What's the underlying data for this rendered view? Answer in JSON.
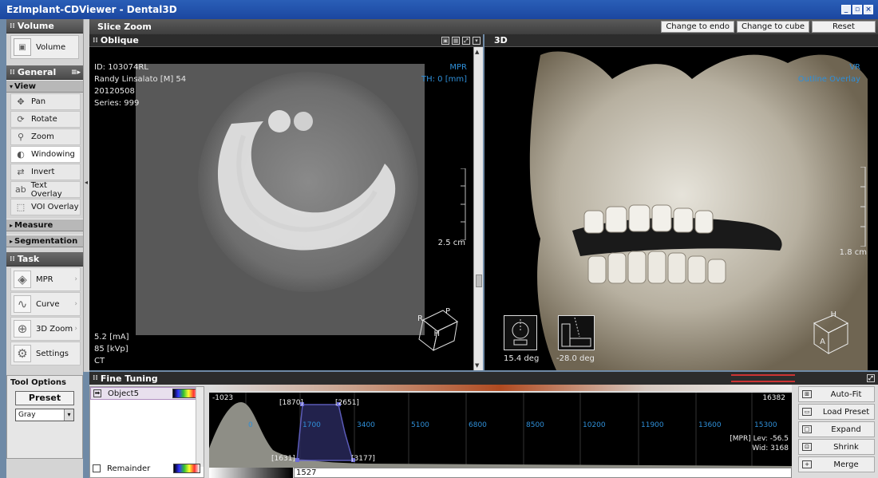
{
  "window": {
    "title": "EzImplant-CDViewer - Dental3D"
  },
  "left": {
    "volume_section": "Volume",
    "volume_button": "Volume",
    "general_section": "General",
    "view_subheader": "View",
    "view_tools": [
      {
        "label": "Pan",
        "icon": "pan-icon"
      },
      {
        "label": "Rotate",
        "icon": "rotate-icon"
      },
      {
        "label": "Zoom",
        "icon": "zoom-icon"
      },
      {
        "label": "Windowing",
        "icon": "windowing-icon"
      },
      {
        "label": "Invert",
        "icon": "invert-icon"
      },
      {
        "label": "Text Overlay",
        "icon": "text-overlay-icon"
      },
      {
        "label": "VOI Overlay",
        "icon": "voi-overlay-icon"
      }
    ],
    "measure_subheader": "Measure",
    "segmentation_subheader": "Segmentation",
    "task_section": "Task",
    "task_tools": [
      {
        "label": "MPR",
        "icon": "mpr-icon"
      },
      {
        "label": "Curve",
        "icon": "curve-icon"
      },
      {
        "label": "3D Zoom",
        "icon": "3d-zoom-icon"
      },
      {
        "label": "Settings",
        "icon": "settings-icon"
      }
    ],
    "tool_options": {
      "title": "Tool Options",
      "preset_label": "Preset",
      "select_value": "Gray"
    }
  },
  "slicezoom": {
    "title": "Slice Zoom",
    "buttons": [
      "Change to endo",
      "Change to cube",
      "Reset"
    ]
  },
  "oblique": {
    "title": "Oblique",
    "patient_id": "ID: 103074RL",
    "patient_name": "Randy Linsalato [M] 54",
    "date": "20120508",
    "series": "Series: 999",
    "mode": "MPR",
    "thickness": "TH: 0 [mm]",
    "scale": "2.5 cm",
    "ma": "5.2 [mA]",
    "kvp": "85 [kVp]",
    "modality": "CT",
    "cube": {
      "r": "R",
      "p": "P",
      "h": "H"
    }
  },
  "view3d": {
    "title": "3D",
    "mode": "VR",
    "overlay": "Outline Overlay",
    "scale": "1.8 cm",
    "angle1": "15.4 deg",
    "angle2": "-28.0 deg",
    "cube": {
      "h": "H",
      "a": "A"
    }
  },
  "finetuning": {
    "title": "Fine Tuning",
    "objects": [
      {
        "label": "Object5",
        "selected": true
      },
      {
        "label": "Remainder",
        "selected": false
      }
    ],
    "hist": {
      "min": "-1023",
      "max": "16382",
      "ctrl_tl": "[1870]",
      "ctrl_tr": "[2651]",
      "ctrl_bl": "[1631]",
      "ctrl_br": "[3177]",
      "ticks": [
        "0",
        "1700",
        "3400",
        "5100",
        "6800",
        "8500",
        "10200",
        "11900",
        "13600",
        "15300"
      ],
      "lev": "[MPR] Lev:  -56.5",
      "wid": "Wid:  3168",
      "current": "1527"
    },
    "buttons": [
      {
        "label": "Auto-Fit",
        "icon": "auto-fit-icon"
      },
      {
        "label": "Load Preset",
        "icon": "load-preset-icon"
      },
      {
        "label": "Expand",
        "icon": "expand-icon"
      },
      {
        "label": "Shrink",
        "icon": "shrink-icon"
      },
      {
        "label": "Merge",
        "icon": "merge-icon"
      }
    ]
  }
}
